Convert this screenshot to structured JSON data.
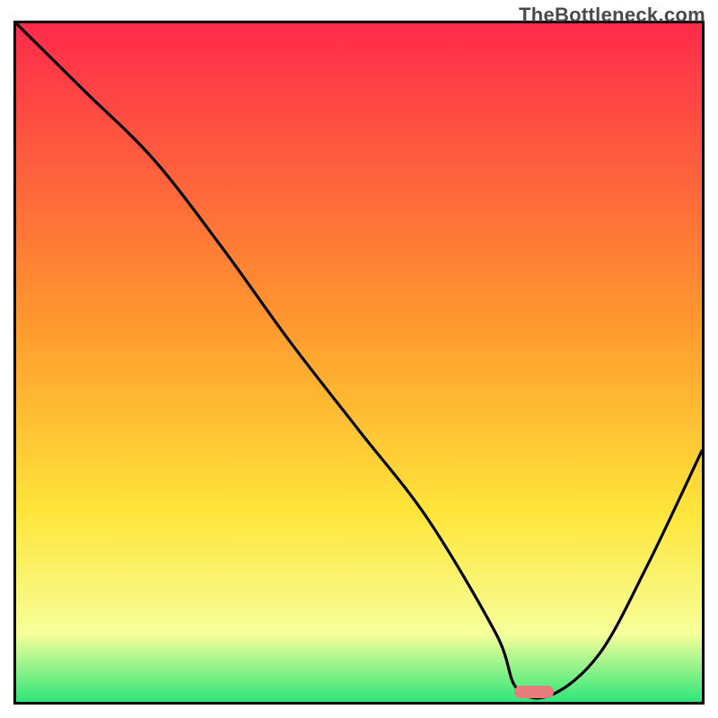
{
  "watermark": "TheBottleneck.com",
  "colors": {
    "top": "#ff2a4b",
    "mid_upper": "#ff9b2e",
    "mid": "#ffe53a",
    "low": "#f6ff9a",
    "bottom": "#2ee67a",
    "curve": "#000000",
    "marker": "#e87b7b"
  },
  "plot": {
    "inner_width": 764,
    "inner_height": 756,
    "marker": {
      "x_frac": 0.755,
      "y_frac": 0.986
    }
  },
  "chart_data": {
    "type": "line",
    "title": "",
    "xlabel": "",
    "ylabel": "",
    "xlim": [
      0,
      100
    ],
    "ylim": [
      0,
      100
    ],
    "series": [
      {
        "name": "bottleneck-curve",
        "x": [
          0,
          10,
          20,
          30,
          40,
          50,
          60,
          70,
          73,
          78,
          85,
          92,
          100
        ],
        "y": [
          100,
          90,
          80,
          67,
          53,
          40,
          27,
          10,
          2,
          1,
          7,
          20,
          37
        ]
      }
    ],
    "annotations": [
      {
        "name": "optimal-marker",
        "x": 75.5,
        "y": 1.4,
        "shape": "pill",
        "color": "#e87b7b"
      }
    ],
    "background_gradient": {
      "direction": "vertical",
      "stops": [
        {
          "pos": 0.0,
          "color": "#ff2a4b"
        },
        {
          "pos": 0.45,
          "color": "#ff9b2e"
        },
        {
          "pos": 0.72,
          "color": "#ffe53a"
        },
        {
          "pos": 0.9,
          "color": "#f6ff9a"
        },
        {
          "pos": 1.0,
          "color": "#2ee67a"
        }
      ]
    }
  }
}
